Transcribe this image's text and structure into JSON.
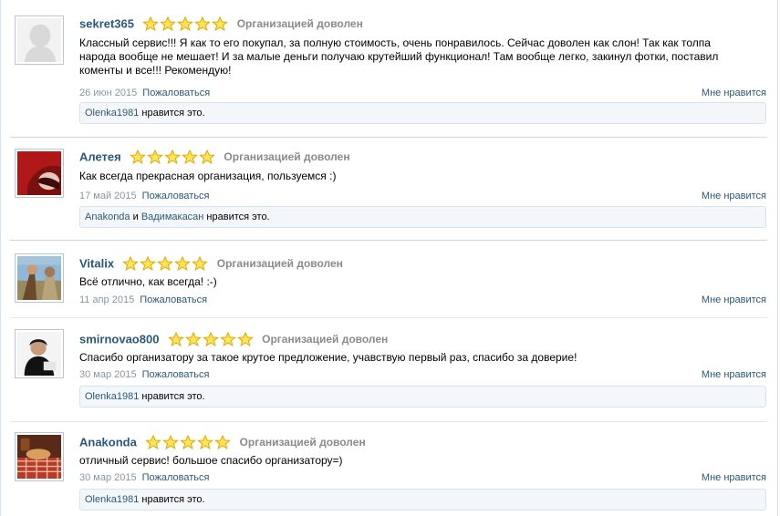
{
  "reviews": [
    {
      "name": "sekret365",
      "status": "Организацией доволен",
      "text": "Классный сервис!!! Я как то его покупал, за полную стоимость, очень понравилось. Сейчас доволен как слон! Так как толпа народа вообще не мешает! И за малые деньги получаю крутейший функционал! Там вообще легко, закинул фотки, поставил коменты и все!!! Рекомендую!",
      "date": "26 июн 2015",
      "report": "Пожаловаться",
      "like": "Мне нравится",
      "likes": {
        "user1": "Olenka1981",
        "sep": "",
        "user2": "",
        "suffix": " нравится это."
      },
      "rating": 5,
      "avatar_icon": "default-silhouette"
    },
    {
      "name": "Алетея",
      "status": "Организацией доволен",
      "text": "Как всегда прекрасная организация, пользуемся :)",
      "date": "17 май 2015",
      "report": "Пожаловаться",
      "like": "Мне нравится",
      "likes": {
        "user1": "Anakonda",
        "sep": " и ",
        "user2": "Вадимакасан",
        "suffix": " нравится это."
      },
      "rating": 5,
      "avatar_icon": "red-photo"
    },
    {
      "name": "Vitalix",
      "status": "Организацией доволен",
      "text": "Всё отлично, как всегда! :-)",
      "date": "11 апр 2015",
      "report": "Пожаловаться",
      "like": "Мне нравится",
      "rating": 5,
      "avatar_icon": "outdoor-photo"
    },
    {
      "name": "smirnovao800",
      "status": "Организацией доволен",
      "text": "Спасибо организатору за такое крутое предложение, учавствую первый раз, спасибо за доверие!",
      "date": "30 мар 2015",
      "report": "Пожаловаться",
      "like": "Мне нравится",
      "likes": {
        "user1": "Olenka1981",
        "sep": "",
        "user2": "",
        "suffix": " нравится это."
      },
      "rating": 5,
      "avatar_icon": "person-photo"
    },
    {
      "name": "Anakonda",
      "status": "Организацией доволен",
      "text": "отличный сервис! большое спасибо организатору=)",
      "date": "30 мар 2015",
      "report": "Пожаловаться",
      "like": "Мне нравится",
      "likes": {
        "user1": "Olenka1981",
        "sep": "",
        "user2": "",
        "suffix": " нравится это."
      },
      "rating": 5,
      "avatar_icon": "food-photo"
    }
  ],
  "colors": {
    "link": "#2b587a",
    "star_fill": "#ffe45a",
    "star_stroke": "#e0a800",
    "muted": "#8a8a8a"
  }
}
